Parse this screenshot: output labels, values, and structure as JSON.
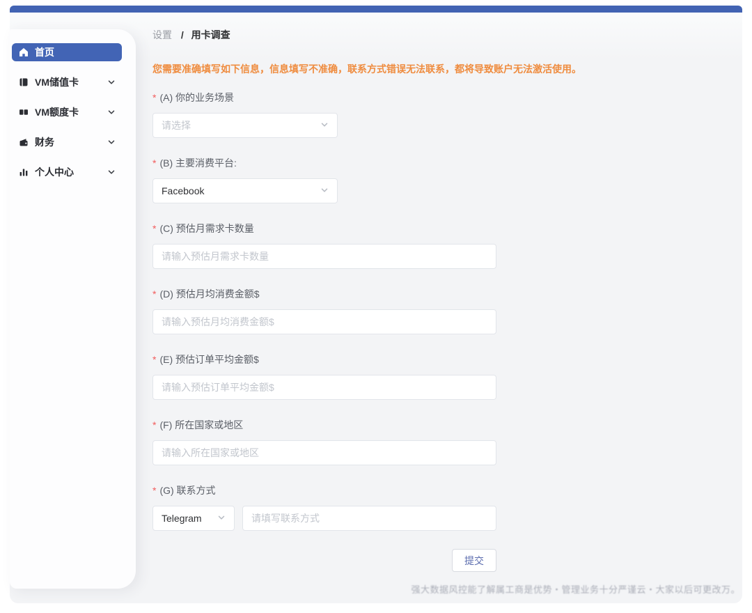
{
  "colors": {
    "accent_blue": "#4263b3",
    "active_menu_blue": "#4264b5",
    "warning_orange": "#ef8c3f",
    "required_red": "#f25c5c",
    "content_bg": "#f3f4f6"
  },
  "sidebar": {
    "items": [
      {
        "label": "首页",
        "icon": "home-icon",
        "active": true,
        "has_submenu": false
      },
      {
        "label": "VM储值卡",
        "icon": "stored-card-icon",
        "active": false,
        "has_submenu": true
      },
      {
        "label": "VM额度卡",
        "icon": "quota-card-icon",
        "active": false,
        "has_submenu": true
      },
      {
        "label": "财务",
        "icon": "finance-icon",
        "active": false,
        "has_submenu": true
      },
      {
        "label": "个人中心",
        "icon": "profile-icon",
        "active": false,
        "has_submenu": true
      }
    ]
  },
  "breadcrumb": {
    "parent": "设置",
    "separator": "/",
    "current": "用卡调查"
  },
  "warning": "您需要准确填写如下信息，信息填写不准确，联系方式错误无法联系，都将导致账户无法激活使用。",
  "form": {
    "required_marker": "*",
    "fields": [
      {
        "id": "A",
        "label": "(A) 你的业务场景",
        "type": "select",
        "placeholder": "请选择",
        "value": ""
      },
      {
        "id": "B",
        "label": "(B) 主要消费平台:",
        "type": "select",
        "value": "Facebook"
      },
      {
        "id": "C",
        "label": "(C) 预估月需求卡数量",
        "type": "input",
        "placeholder": "请输入预估月需求卡数量"
      },
      {
        "id": "D",
        "label": "(D) 预估月均消费金额$",
        "type": "input",
        "placeholder": "请输入预估月均消费金额$"
      },
      {
        "id": "E",
        "label": "(E) 预估订单平均金额$",
        "type": "input",
        "placeholder": "请输入预估订单平均金额$"
      },
      {
        "id": "F",
        "label": "(F) 所在国家或地区",
        "type": "input",
        "placeholder": "请输入所在国家或地区"
      },
      {
        "id": "G",
        "label": "(G) 联系方式",
        "type": "select-input",
        "select_value": "Telegram",
        "placeholder": "请填写联系方式"
      }
    ],
    "submit_label": "提交"
  },
  "footer": {
    "watermark": "强大数据风控能了解属工商是优势・管理业务十分严谨云・大家以后可更改万。"
  }
}
